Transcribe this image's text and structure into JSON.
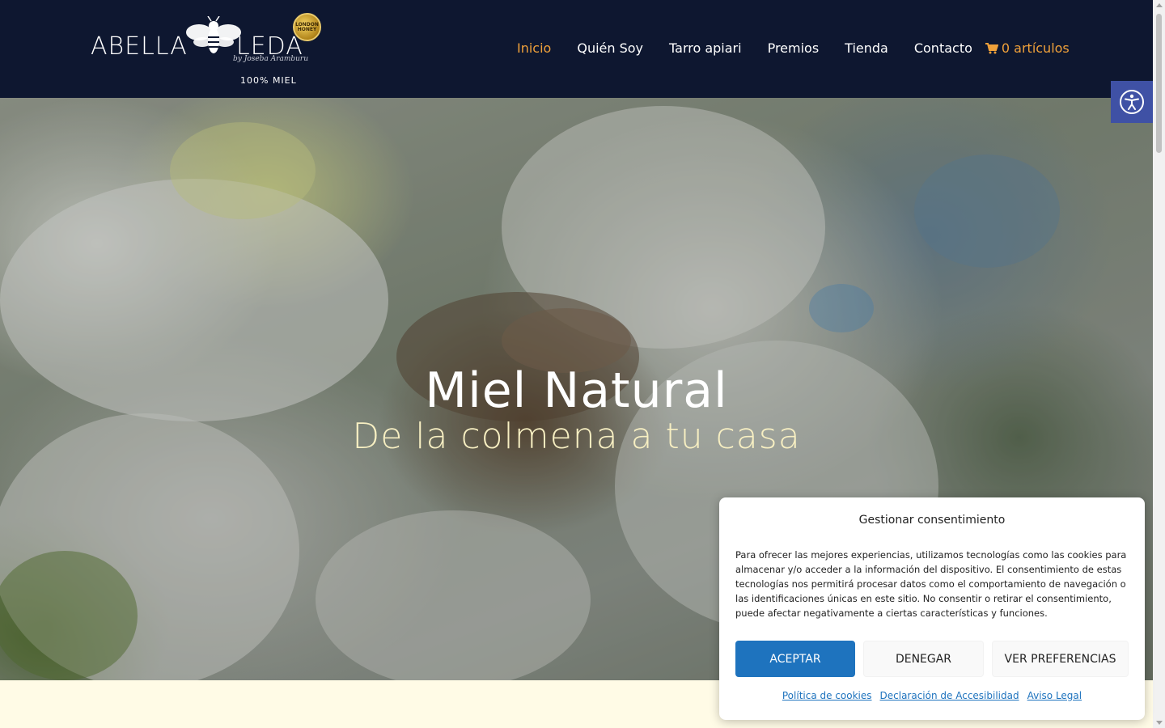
{
  "header": {
    "logo": {
      "name_left": "ABELLA",
      "name_right": "LEDA",
      "byline": "by Joseba Aramburu",
      "seal_text": "LONDON HONEY",
      "tagline": "100% MIEL"
    },
    "nav": {
      "items": [
        {
          "label": "Inicio",
          "active": true
        },
        {
          "label": "Quién Soy",
          "active": false
        },
        {
          "label": "Tarro apiari",
          "active": false
        },
        {
          "label": "Premios",
          "active": false
        },
        {
          "label": "Tienda",
          "active": false
        },
        {
          "label": "Contacto",
          "active": false
        }
      ],
      "cart_label": "0 artículos",
      "cart_icon": "cart-icon"
    }
  },
  "accessibility": {
    "icon": "accessibility-icon"
  },
  "hero": {
    "title": "Miel Natural",
    "subtitle": "De la colmena a tu casa"
  },
  "cookie_dialog": {
    "title": "Gestionar consentimiento",
    "text": "Para ofrecer las mejores experiencias, utilizamos tecnologías como las cookies para almacenar y/o acceder a la información del dispositivo. El consentimiento de estas tecnologías nos permitirá procesar datos como el comportamiento de navegación o las identificaciones únicas en este sitio. No consentir o retirar el consentimiento, puede afectar negativamente a ciertas características y funciones.",
    "accept_label": "ACEPTAR",
    "deny_label": "DENEGAR",
    "preferences_label": "VER PREFERENCIAS",
    "links": [
      "Política de cookies",
      "Declaración de Accesibilidad",
      "Aviso Legal"
    ]
  },
  "colors": {
    "header_bg": "#0e1730",
    "nav_active": "#f0a13a",
    "accept_button": "#1e73be",
    "accessibility_button": "#3f51a5",
    "page_bg": "#fffbe6"
  }
}
